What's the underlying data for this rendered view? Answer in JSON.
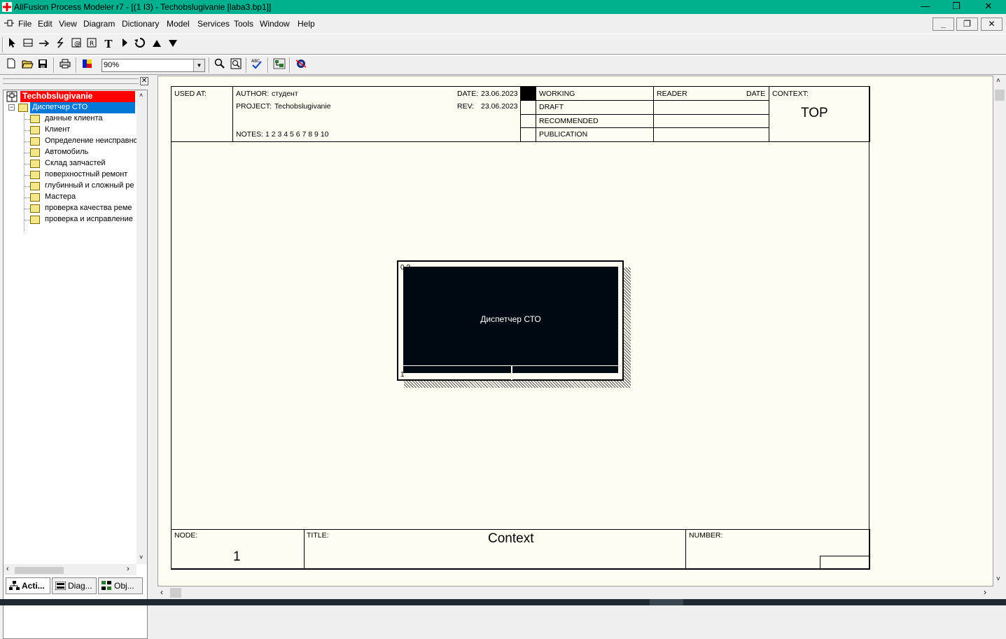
{
  "window": {
    "title": "AllFusion Process Modeler r7 - [(1 I3)  - Techobslugivanie  [laba3.bp1]]",
    "minimize": "—",
    "restore": "❐",
    "close": "✕"
  },
  "menu": {
    "items": [
      "File",
      "Edit",
      "View",
      "Diagram",
      "Dictionary",
      "Model",
      "Services",
      "Tools",
      "Window",
      "Help"
    ],
    "mdi_min": "_",
    "mdi_restore": "❐",
    "mdi_close": "✕"
  },
  "toolbar": {
    "zoom_value": "90%",
    "zoom_arrow": "▼"
  },
  "tree": {
    "root": "Techobslugivanie",
    "selected": "Диспетчер СТО",
    "items": [
      "данные клиента",
      "Клиент",
      "Определение неисправно",
      "Автомобиль",
      "Склад запчастей",
      "поверхностный ремонт",
      "глубинный и сложный ре",
      "Мастера",
      "проверка качества реме",
      "проверка и исправление"
    ]
  },
  "tabs": [
    "Acti...",
    "Diag...",
    "Obj..."
  ],
  "diagram": {
    "used_at": "USED AT:",
    "author_label": "AUTHOR:",
    "author": "студент",
    "project_label": "PROJECT:",
    "project": "Techobslugivanie",
    "date_label": "DATE:",
    "date": "23.06.2023",
    "rev_label": "REV:",
    "rev": "23.06.2023",
    "notes": "NOTES:  1  2  3  4  5  6  7  8  9  10",
    "status": [
      "WORKING",
      "DRAFT",
      "RECOMMENDED",
      "PUBLICATION"
    ],
    "reader": "READER",
    "reader_date": "DATE",
    "context_label": "CONTEXT:",
    "context_value": "TOP",
    "node_label": "NODE:",
    "node_value": "1",
    "title_label": "TITLE:",
    "title_value": "Context",
    "number_label": "NUMBER:",
    "activity_name": "Диспетчер СТО",
    "activity_cost": "0 ?",
    "activity_num": "1"
  }
}
